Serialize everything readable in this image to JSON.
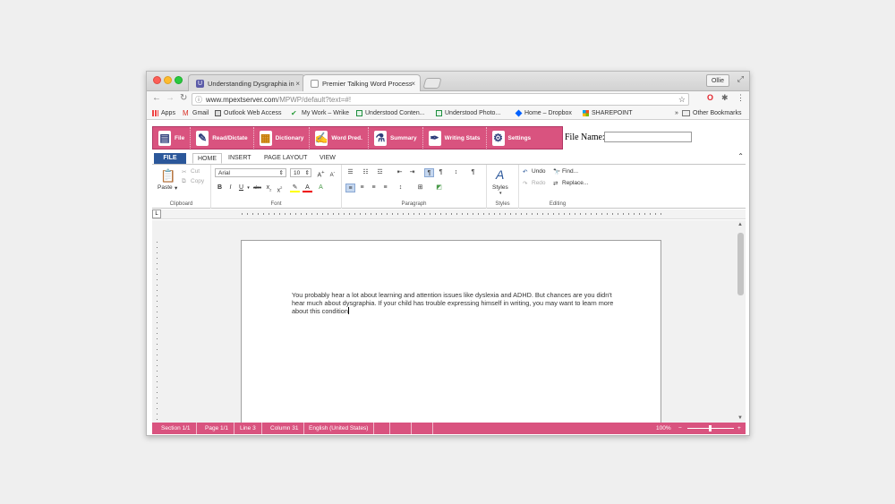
{
  "browser": {
    "tabs": [
      {
        "title": "Understanding Dysgraphia in",
        "favicon": "U",
        "active": false
      },
      {
        "title": "Premier Talking Word Process",
        "favicon": "doc",
        "active": true
      }
    ],
    "user": "Ollie",
    "url_host": "www.mpextserver.com",
    "url_path": "/MPWP/default?text=#!",
    "bookmarks": [
      {
        "label": "Apps",
        "icon": "apps-grid-icon"
      },
      {
        "label": "Gmail",
        "icon": "gmail-icon"
      },
      {
        "label": "Outlook Web Access",
        "icon": "outlook-icon"
      },
      {
        "label": "My Work – Wrike",
        "icon": "wrike-check-icon"
      },
      {
        "label": "Understood Conten...",
        "icon": "sheet-icon"
      },
      {
        "label": "Understood Photo...",
        "icon": "sheet-icon"
      },
      {
        "label": "Home – Dropbox",
        "icon": "dropbox-icon"
      },
      {
        "label": "SHAREPOINT",
        "icon": "windows-logo-icon"
      }
    ],
    "more_bookmarks": "»",
    "other_bookmarks": "Other Bookmarks"
  },
  "app_toolbar": {
    "items": [
      "File",
      "Read/Dictate",
      "Dictionary",
      "Word Pred.",
      "Summary",
      "Writing Stats",
      "Settings"
    ],
    "file_name_label": "File Name:",
    "file_name_value": ""
  },
  "ribbon_tabs": [
    "FILE",
    "HOME",
    "INSERT",
    "PAGE LAYOUT",
    "VIEW"
  ],
  "ribbon": {
    "clipboard": {
      "label": "Clipboard",
      "paste": "Paste",
      "cut": "Cut",
      "copy": "Copy"
    },
    "font": {
      "label": "Font",
      "font_name": "Arial",
      "font_size": "10"
    },
    "paragraph": {
      "label": "Paragraph"
    },
    "styles": {
      "label": "Styles",
      "button": "Styles"
    },
    "editing": {
      "label": "Editing",
      "undo": "Undo",
      "redo": "Redo",
      "find": "Find...",
      "replace": "Replace..."
    }
  },
  "document": {
    "text": "You probably hear a lot about learning and attention issues like dyslexia and ADHD. But chances are you didn't hear much about dysgraphia. If your child has trouble expressing himself in writing, you may want to learn more about this condition"
  },
  "status_bar": {
    "section": "Section 1/1",
    "page": "Page 1/1",
    "line": "Line 3",
    "column": "Column 31",
    "language": "English (United States)",
    "zoom": "100%",
    "zoom_out": "−",
    "zoom_in": "+"
  },
  "colors": {
    "pink": "#d9537f",
    "file_tab": "#2b579a"
  }
}
